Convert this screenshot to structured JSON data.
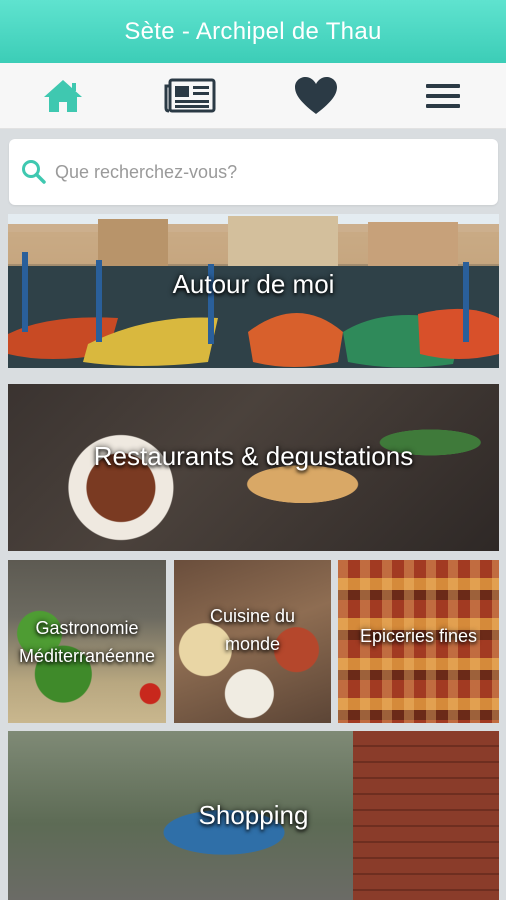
{
  "app": {
    "title": "Sète - Archipel de Thau"
  },
  "nav": {
    "items": [
      {
        "name": "home",
        "icon": "home-icon"
      },
      {
        "name": "news",
        "icon": "newspaper-icon"
      },
      {
        "name": "favorites",
        "icon": "heart-icon"
      },
      {
        "name": "menu",
        "icon": "hamburger-menu-icon"
      }
    ],
    "active_color": "#3fc8b0",
    "icon_color": "#2b3a45"
  },
  "search": {
    "placeholder": "Que recherchez-vous?",
    "icon": "search-icon",
    "value": ""
  },
  "categories": {
    "autour": "Autour de moi",
    "restaurants": "Restaurants & degustations",
    "gastronomie_line1": "Gastronomie",
    "gastronomie_line2": "Méditerranéenne",
    "monde_line1": "Cuisine du",
    "monde_line2": "monde",
    "epiceries": "Epiceries fines",
    "shopping": "Shopping"
  },
  "colors": {
    "header": "#4fd9c3",
    "background": "#d9dde0"
  }
}
